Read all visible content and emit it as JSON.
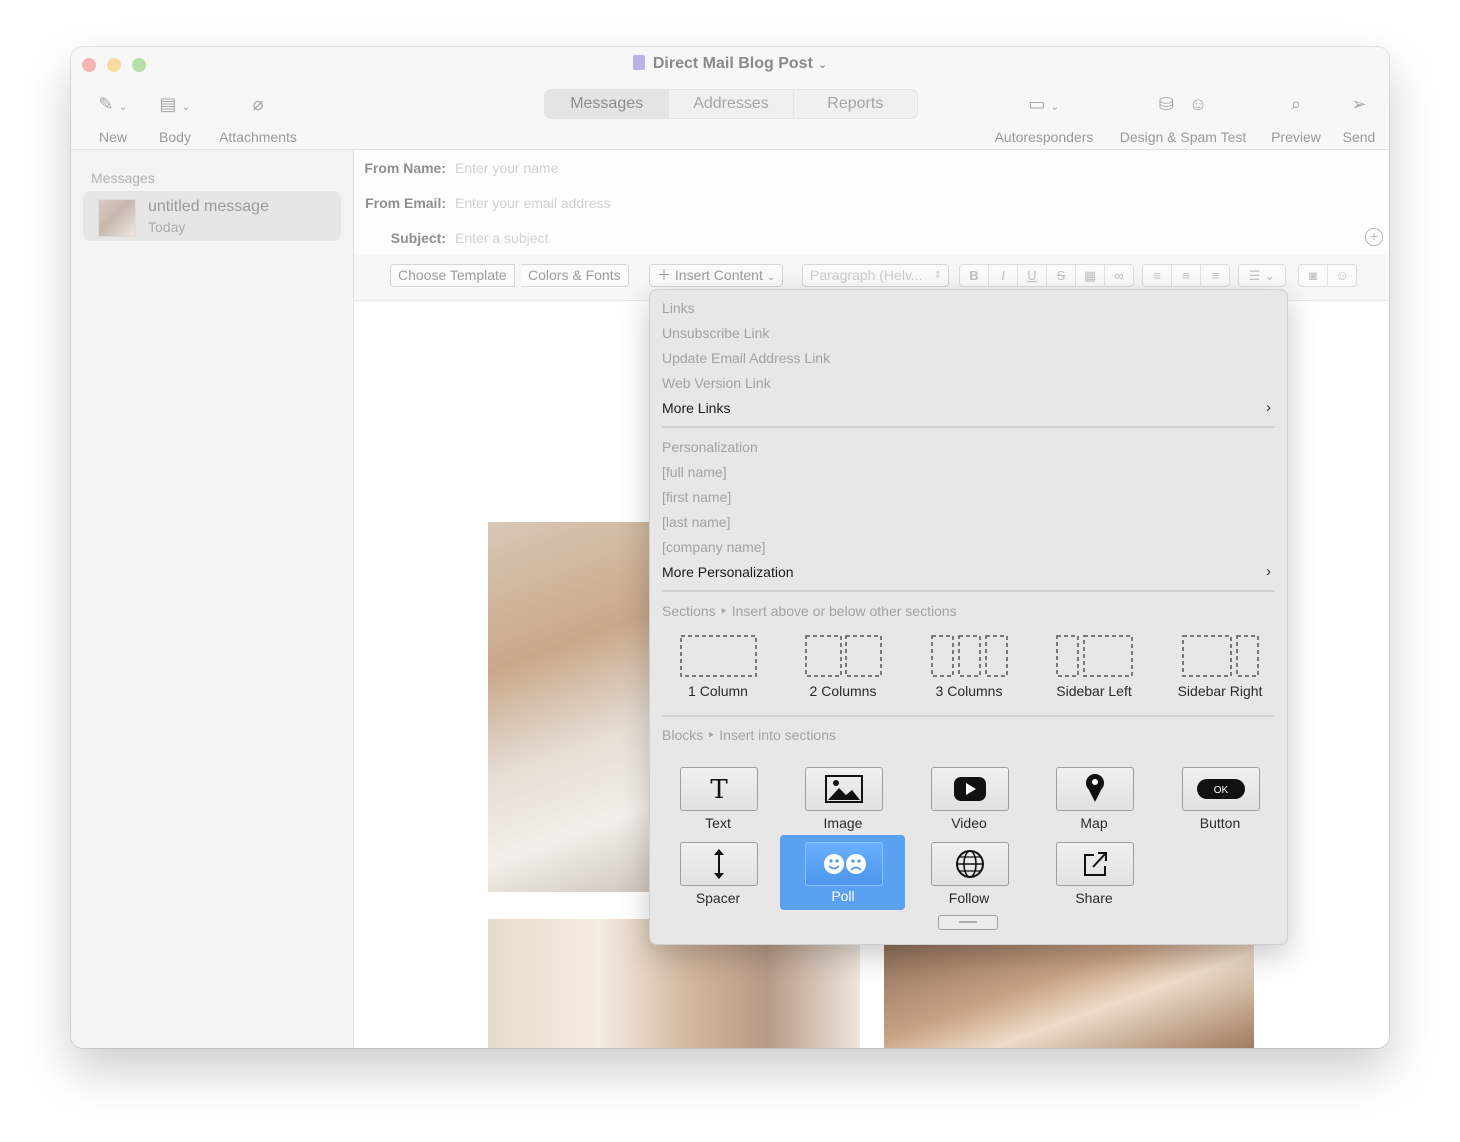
{
  "window": {
    "title": "Direct Mail Blog Post"
  },
  "toolbar": {
    "left": [
      {
        "label": "New",
        "icon": "compose-icon"
      },
      {
        "label": "Body",
        "icon": "body-layout-icon"
      },
      {
        "label": "Attachments",
        "icon": "paperclip-icon"
      }
    ],
    "segments": [
      "Messages",
      "Addresses",
      "Reports"
    ],
    "right": [
      {
        "label": "Autoresponders",
        "icon": "autoresponder-icon"
      },
      {
        "label": "Design & Spam Test",
        "icon": "design-test-icon"
      },
      {
        "label": "Preview",
        "icon": "preview-icon"
      },
      {
        "label": "Send",
        "icon": "paper-plane-icon"
      }
    ]
  },
  "sidebar": {
    "heading": "Messages",
    "item": {
      "title": "untitled message",
      "date": "Today"
    }
  },
  "fields": {
    "from_name": {
      "label": "From Name:",
      "placeholder": "Enter your name"
    },
    "from_email": {
      "label": "From Email:",
      "placeholder": "Enter your email address"
    },
    "subject": {
      "label": "Subject:",
      "placeholder": "Enter a subject"
    }
  },
  "format_bar": {
    "choose_template": "Choose Template",
    "colors_fonts": "Colors & Fonts",
    "insert_content": "Insert Content",
    "paragraph": "Paragraph (Helv...",
    "style_buttons": [
      "B",
      "I",
      "U",
      "S"
    ]
  },
  "menu": {
    "links_heading": "Links",
    "links": [
      "Unsubscribe Link",
      "Update Email Address Link",
      "Web Version Link"
    ],
    "more_links": "More Links",
    "personalization_heading": "Personalization",
    "personalization": [
      "[full name]",
      "[first name]",
      "[last name]",
      "[company name]"
    ],
    "more_personalization": "More Personalization",
    "sections_heading": "Sections ‣ Insert above or below other sections",
    "sections": [
      "1 Column",
      "2 Columns",
      "3 Columns",
      "Sidebar Left",
      "Sidebar Right"
    ],
    "blocks_heading": "Blocks ‣ Insert into sections",
    "blocks": [
      "Text",
      "Image",
      "Video",
      "Map",
      "Button",
      "Spacer",
      "Poll",
      "Follow",
      "Share"
    ],
    "button_block_text": "OK",
    "selected_block": "Poll",
    "accent_color": "#5aa1f2"
  }
}
